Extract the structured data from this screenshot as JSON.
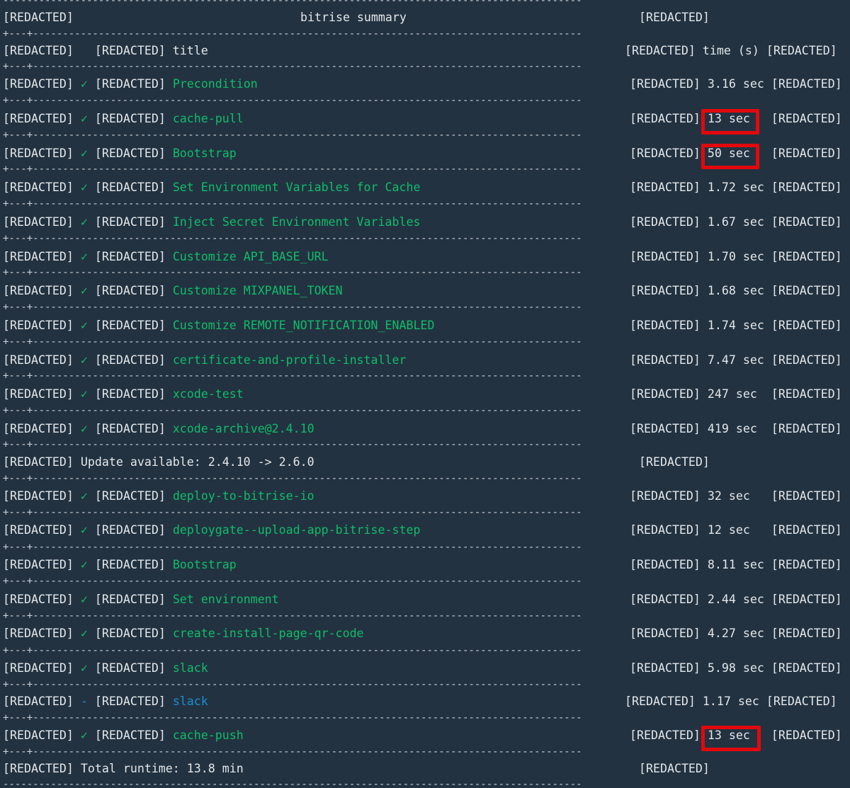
{
  "redacted": "[REDACTED]",
  "header": {
    "summary_title": "bitrise summary",
    "col_title": "title",
    "col_time": "time (s)"
  },
  "separator_top": "---------------------------------------------------------------------------------------------------------------+",
  "separator": "+---+---------------------------------------------------------------------------------------------+-----------+",
  "check_icon": "✓",
  "skip_icon": "-",
  "steps": [
    {
      "icon": "✓",
      "title": "Precondition",
      "time": "3.16 sec",
      "highlight": false,
      "state": "success"
    },
    {
      "icon": "✓",
      "title": "cache-pull",
      "time": "13 sec",
      "highlight": true,
      "state": "success"
    },
    {
      "icon": "✓",
      "title": "Bootstrap",
      "time": "50 sec",
      "highlight": true,
      "state": "success"
    },
    {
      "icon": "✓",
      "title": "Set Environment Variables for Cache",
      "time": "1.72 sec",
      "highlight": false,
      "state": "success"
    },
    {
      "icon": "✓",
      "title": "Inject Secret Environment Variables",
      "time": "1.67 sec",
      "highlight": false,
      "state": "success"
    },
    {
      "icon": "✓",
      "title": "Customize API_BASE_URL",
      "time": "1.70 sec",
      "highlight": false,
      "state": "success"
    },
    {
      "icon": "✓",
      "title": "Customize MIXPANEL_TOKEN",
      "time": "1.68 sec",
      "highlight": false,
      "state": "success"
    },
    {
      "icon": "✓",
      "title": "Customize REMOTE_NOTIFICATION_ENABLED",
      "time": "1.74 sec",
      "highlight": false,
      "state": "success"
    },
    {
      "icon": "✓",
      "title": "certificate-and-profile-installer",
      "time": "7.47 sec",
      "highlight": false,
      "state": "success"
    },
    {
      "icon": "✓",
      "title": "xcode-test",
      "time": "247 sec",
      "highlight": false,
      "state": "success"
    },
    {
      "icon": "✓",
      "title": "xcode-archive@2.4.10",
      "time": "419 sec",
      "highlight": false,
      "state": "success"
    }
  ],
  "update_notice": "Update available: 2.4.10 -> 2.6.0",
  "steps2": [
    {
      "icon": "✓",
      "title": "deploy-to-bitrise-io",
      "time": "32 sec",
      "highlight": false,
      "state": "success"
    },
    {
      "icon": "✓",
      "title": "deploygate--upload-app-bitrise-step",
      "time": "12 sec",
      "highlight": false,
      "state": "success"
    },
    {
      "icon": "✓",
      "title": "Bootstrap",
      "time": "8.11 sec",
      "highlight": false,
      "state": "success"
    },
    {
      "icon": "✓",
      "title": "Set environment",
      "time": "2.44 sec",
      "highlight": false,
      "state": "success"
    },
    {
      "icon": "✓",
      "title": "create-install-page-qr-code",
      "time": "4.27 sec",
      "highlight": false,
      "state": "success"
    },
    {
      "icon": "✓",
      "title": "slack",
      "time": "5.98 sec",
      "highlight": false,
      "state": "success"
    },
    {
      "icon": "-",
      "title": "slack",
      "time": "1.17 sec",
      "highlight": false,
      "state": "skipped"
    },
    {
      "icon": "✓",
      "title": "cache-push",
      "time": "13 sec",
      "highlight": true,
      "state": "success"
    }
  ],
  "total_runtime": "Total runtime: 13.8 min",
  "colors": {
    "background": "#233241",
    "text": "#e3e7ea",
    "success": "#0fbd69",
    "skipped": "#1a8fd6",
    "highlight": "#e2080c"
  }
}
